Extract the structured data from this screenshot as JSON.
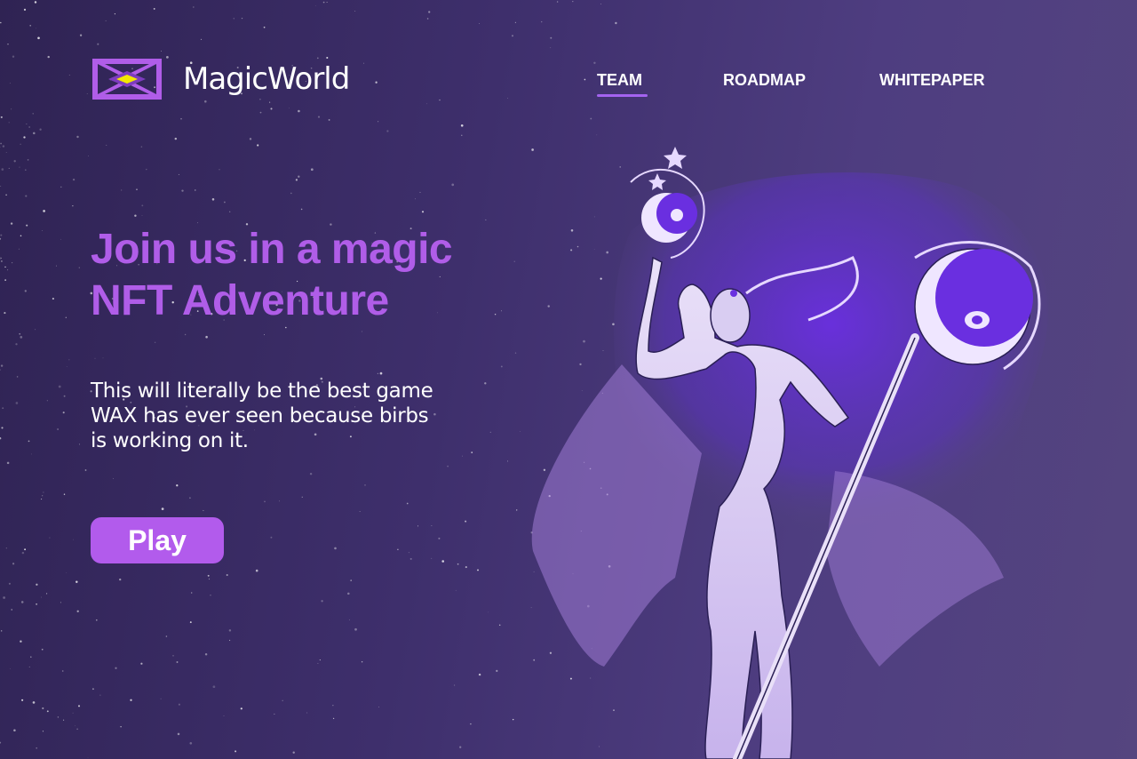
{
  "brand": {
    "name": "MagicWorld",
    "logo_icon": "magic-hourglass-logo",
    "accent": "#b05de8",
    "logo_gem": "#f2e600"
  },
  "nav": {
    "items": [
      {
        "label": "TEAM",
        "active": true
      },
      {
        "label": "ROADMAP",
        "active": false
      },
      {
        "label": "WHITEPAPER",
        "active": false
      }
    ]
  },
  "hero": {
    "headline_line1": "Join us in a magic",
    "headline_line2": "NFT Adventure",
    "subtext_line1": "This will literally be the best game",
    "subtext_line2": "WAX has ever seen because birbs",
    "subtext_line3": "is working on it.",
    "cta_label": "Play",
    "illustration": "moon-sorceress-illustration"
  },
  "colors": {
    "background": "#3e2f6c",
    "button": "#b25bec",
    "text": "#ffffff"
  }
}
